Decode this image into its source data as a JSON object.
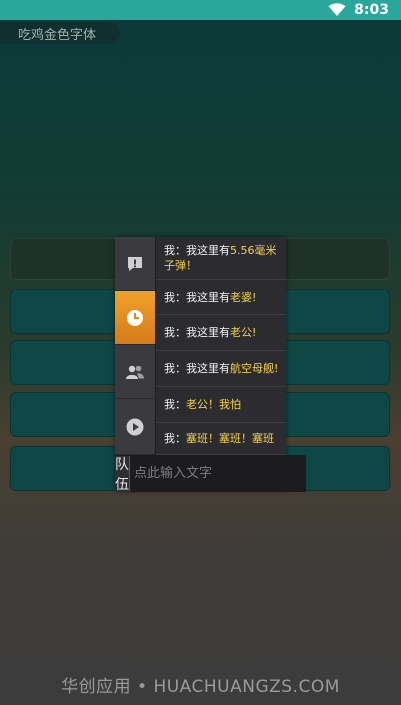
{
  "status_bar": {
    "time": "8:03",
    "bg_color": "#2aa79b"
  },
  "app": {
    "title": "吃鸡金色字体"
  },
  "chat": {
    "side_icons": [
      {
        "icon": "alert-icon"
      },
      {
        "icon": "clock-icon",
        "active": true
      },
      {
        "icon": "users-icon"
      },
      {
        "icon": "play-icon"
      }
    ],
    "messages": [
      {
        "prefix": "我：我这里有",
        "highlight": "5.56毫米",
        "suffix": "",
        "line2": "子弹！"
      },
      {
        "prefix": "我：我这里有",
        "highlight": "老婆!",
        "suffix": ""
      },
      {
        "prefix": "我：我这里有",
        "highlight": "老公!",
        "suffix": ""
      },
      {
        "prefix": "我：我这里有",
        "highlight": "航空母舰!",
        "suffix": ""
      },
      {
        "prefix": "我：",
        "highlight": "老公！我怕",
        "suffix": ""
      },
      {
        "prefix": "我：",
        "highlight": "塞班！塞班！塞班",
        "suffix": ""
      }
    ],
    "team_label": "队伍",
    "input_placeholder": "点此输入文字",
    "highlight_color": "#f4d24a",
    "active_tab_color": "#f0a22a"
  },
  "footer": {
    "watermark": "华创应用 • HUACHUANGZS.COM"
  }
}
